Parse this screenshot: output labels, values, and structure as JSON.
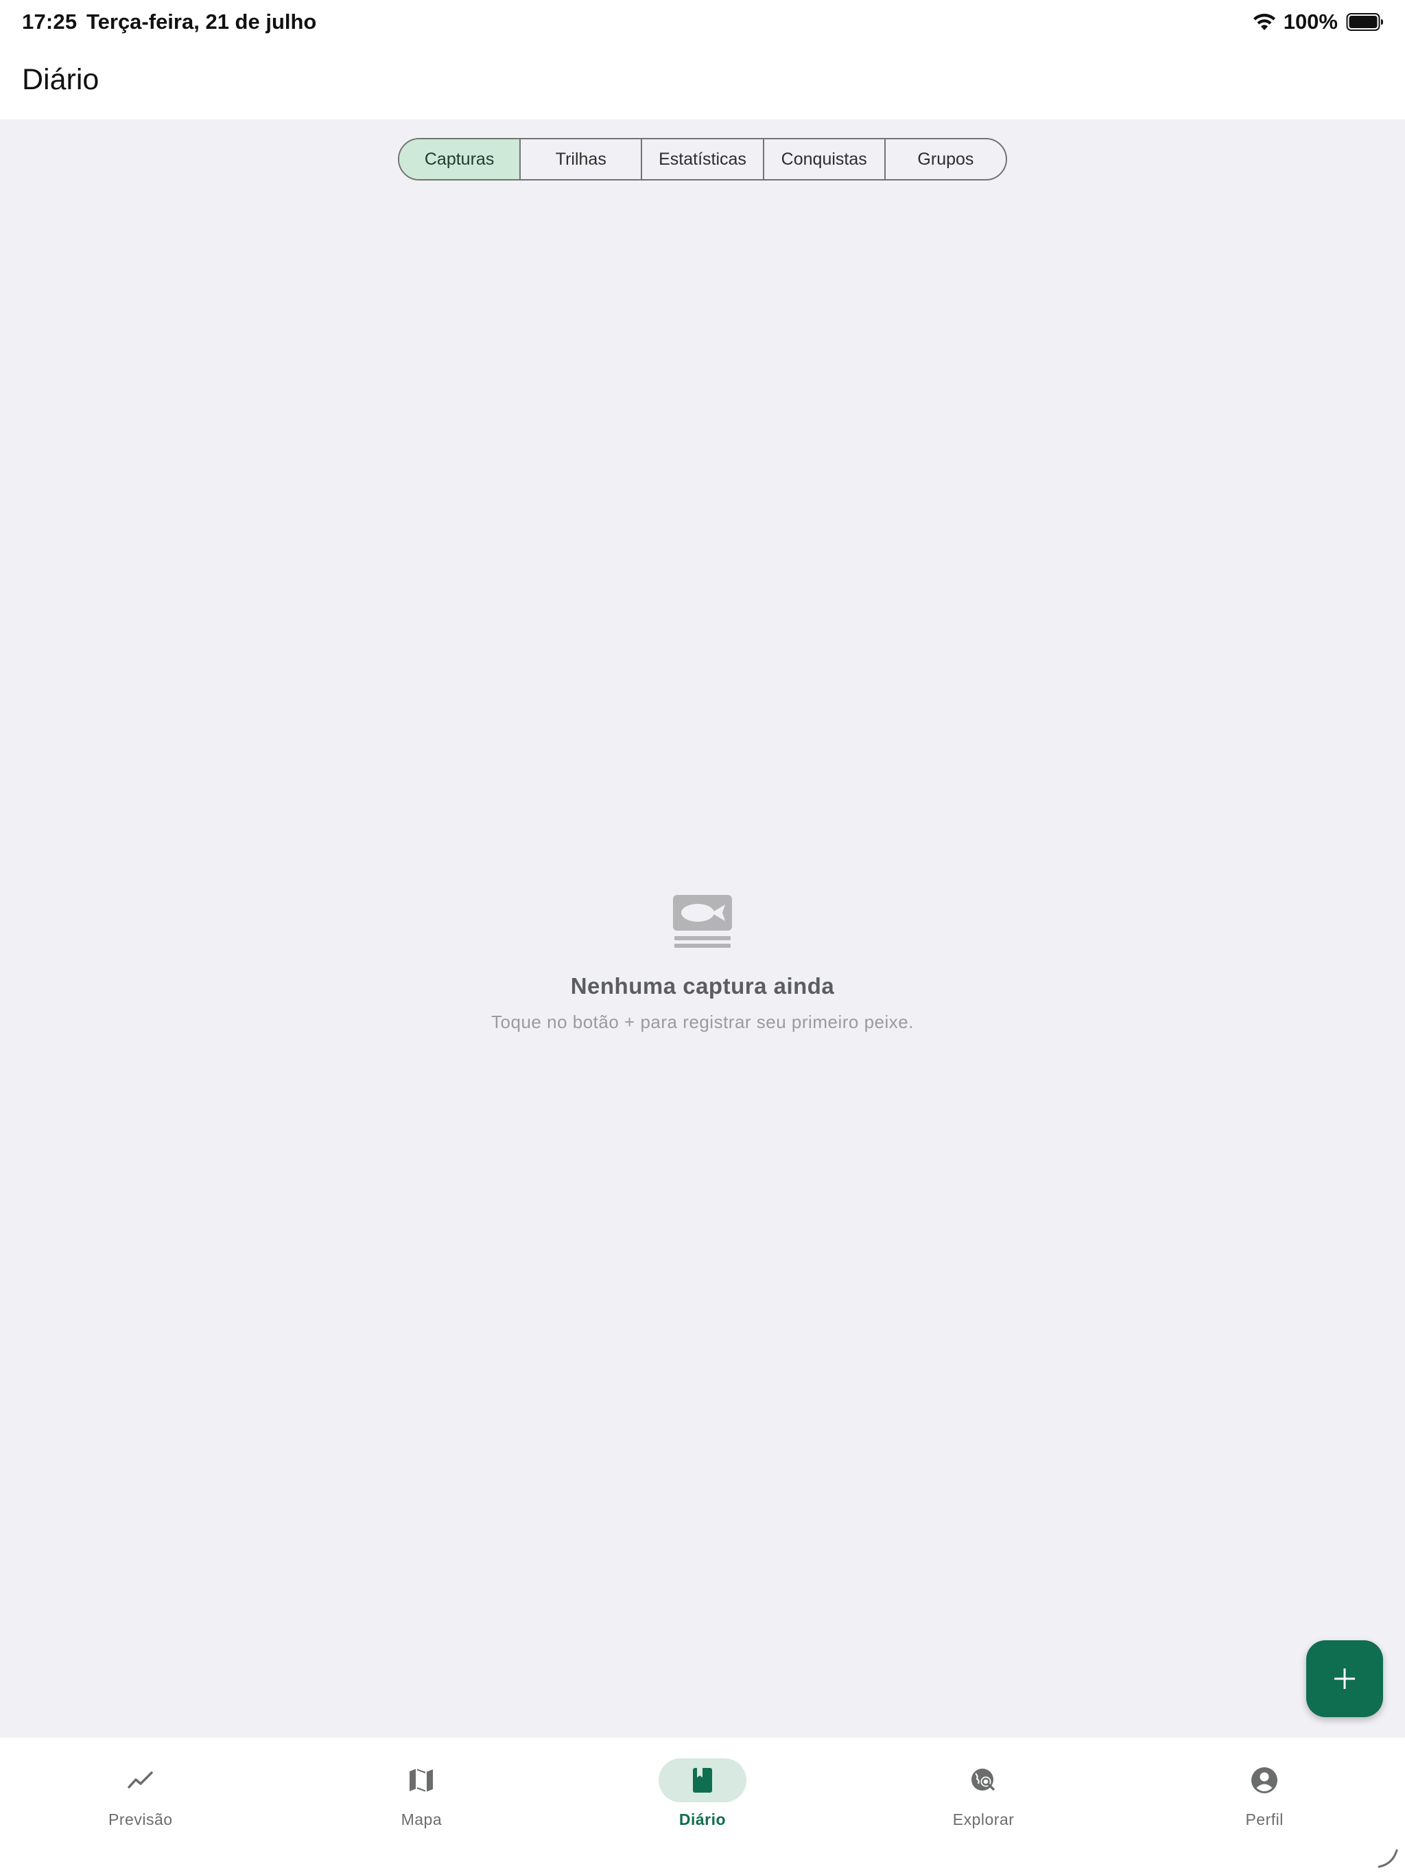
{
  "status_bar": {
    "time": "17:25",
    "date": "Terça-feira, 21 de julho",
    "battery": "100%",
    "icons": [
      "wifi-icon",
      "battery-icon"
    ]
  },
  "app_bar": {
    "title": "Diário"
  },
  "tabs": {
    "selected": 0,
    "items": [
      {
        "label": "Capturas"
      },
      {
        "label": "Trilhas"
      },
      {
        "label": "Estatísticas"
      },
      {
        "label": "Conquistas"
      },
      {
        "label": "Grupos"
      }
    ]
  },
  "empty_state": {
    "icon": "fish-catch-icon",
    "title": "Nenhuma captura ainda",
    "subtitle": "Toque no botão + para registrar seu primeiro peixe."
  },
  "fab": {
    "icon": "plus-icon"
  },
  "bottom_nav": {
    "selected": 2,
    "items": [
      {
        "label": "Previsão",
        "icon": "trending-up-icon"
      },
      {
        "label": "Mapa",
        "icon": "map-icon"
      },
      {
        "label": "Diário",
        "icon": "book-icon"
      },
      {
        "label": "Explorar",
        "icon": "travel-explore-icon"
      },
      {
        "label": "Perfil",
        "icon": "account-circle-icon"
      }
    ]
  },
  "colors": {
    "accent": "#0f6e4f",
    "tab_active_bg": "#cfe9d8",
    "nav_active_bg": "#d7e9e0",
    "background": "#f1f1f5"
  }
}
